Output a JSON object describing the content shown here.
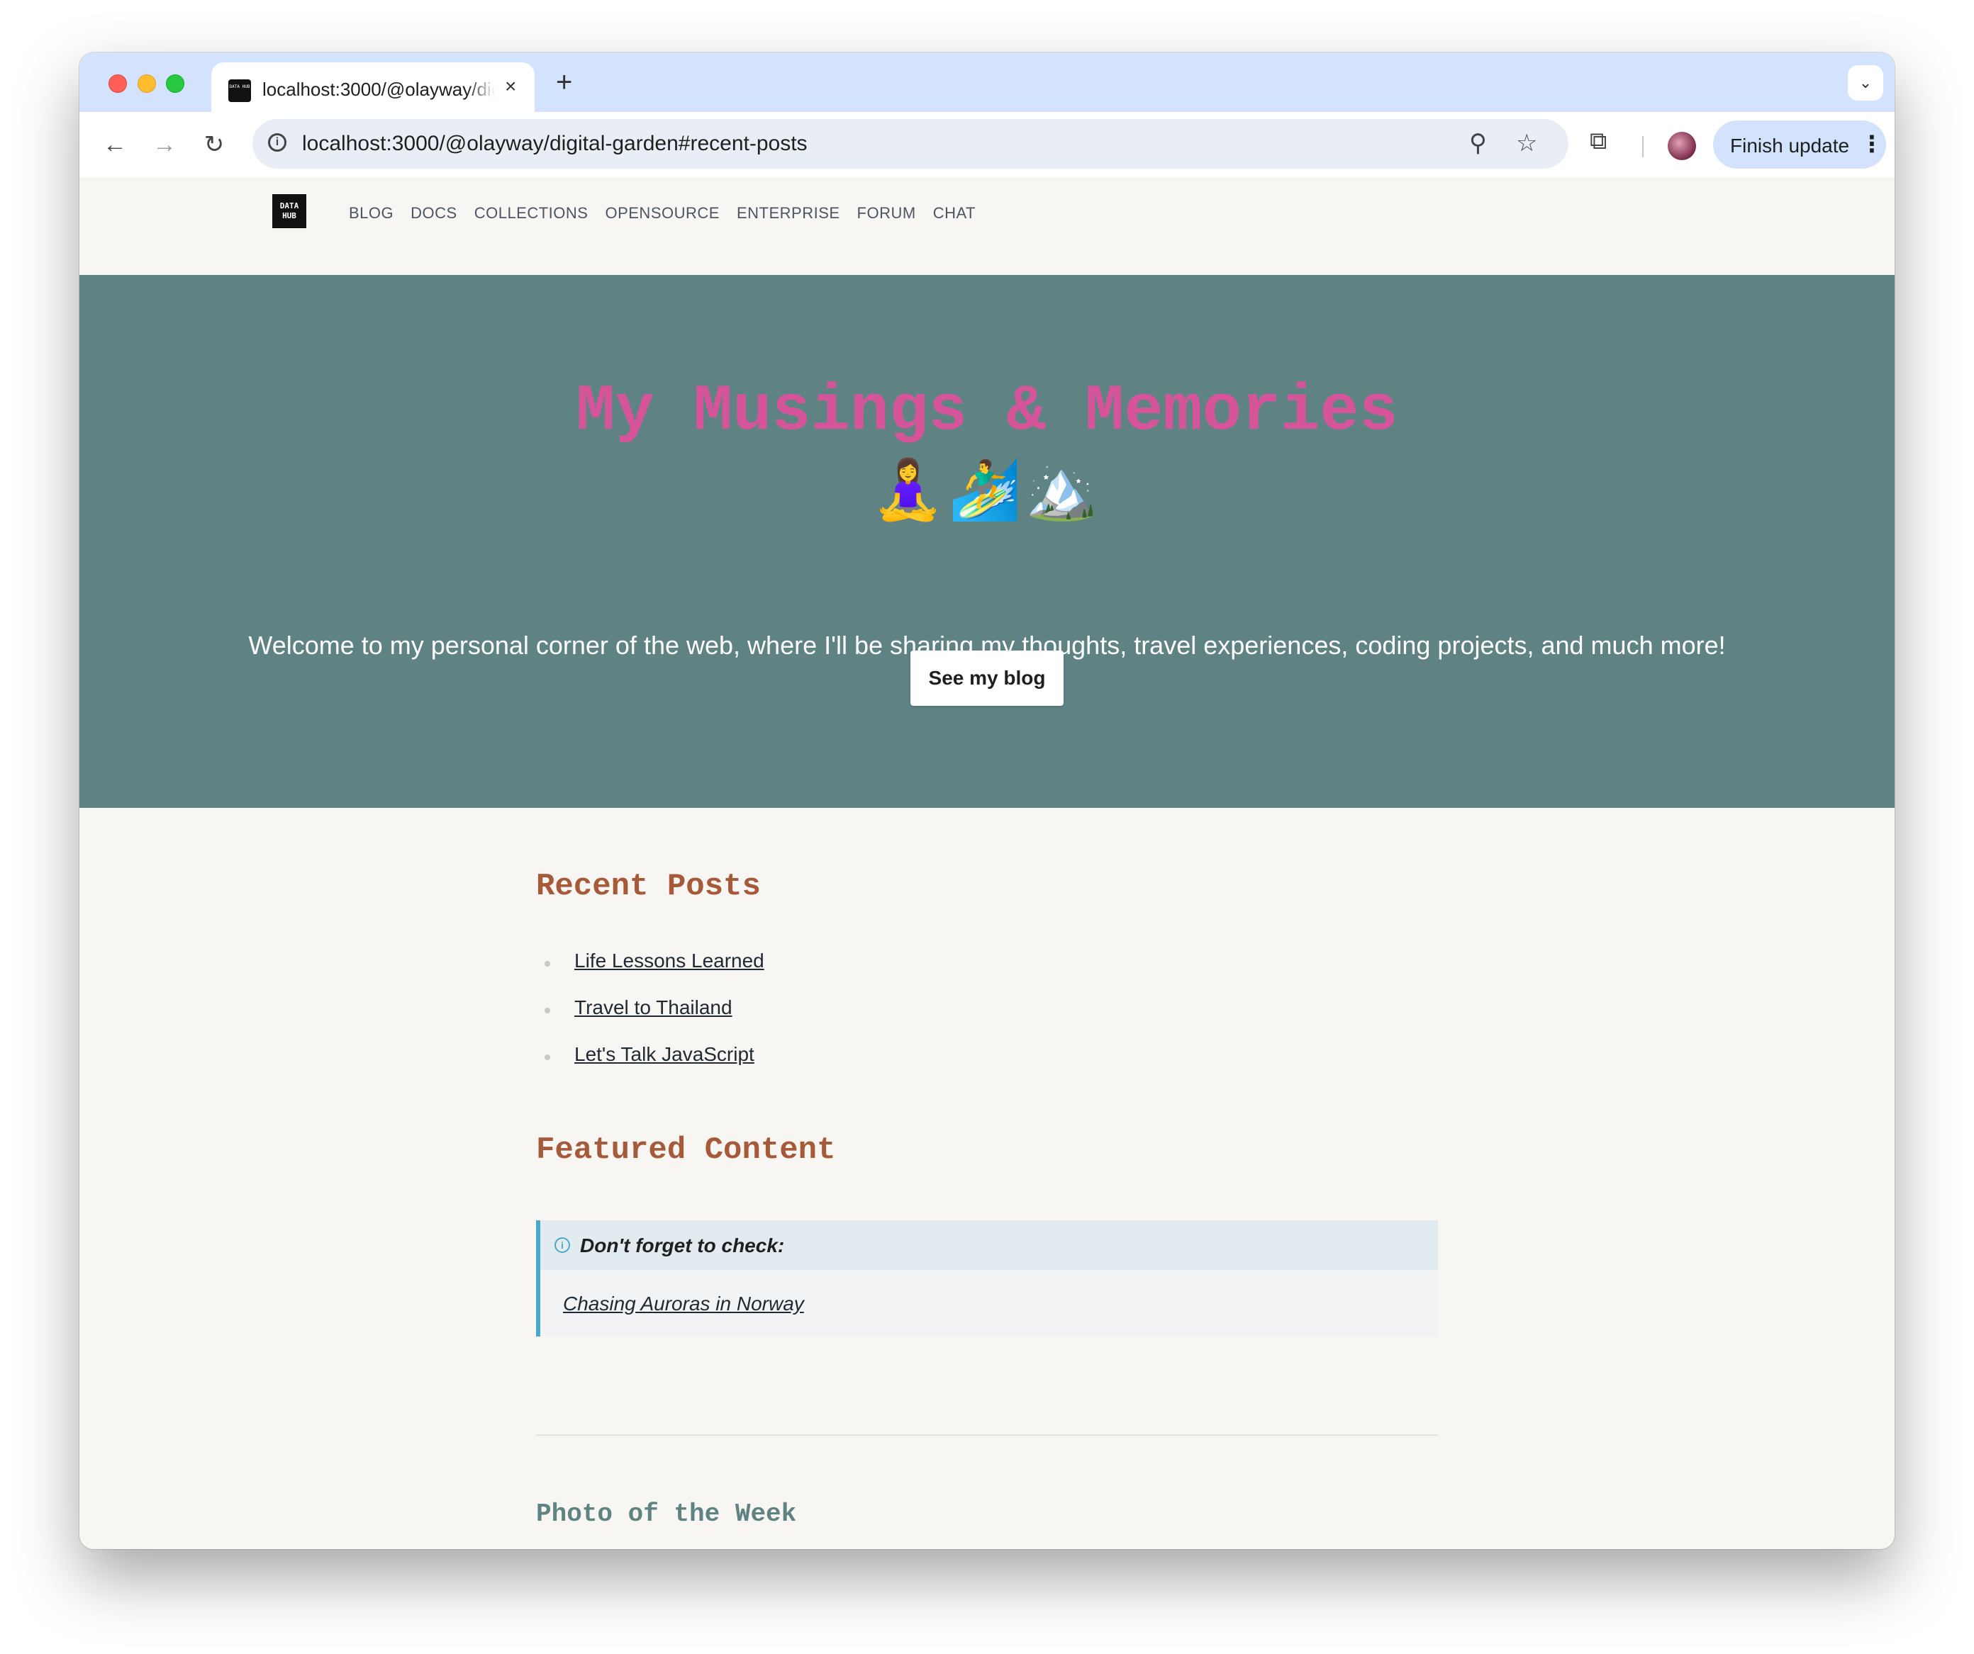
{
  "browser": {
    "tab_title": "localhost:3000/@olayway/digital-garden",
    "tab_close": "×",
    "new_tab": "+",
    "tab_menu": "⌄",
    "url": "localhost:3000/@olayway/digital-garden#recent-posts",
    "finish_update_label": "Finish update",
    "favicon_text": "DATA HUB"
  },
  "site": {
    "logo_text": "DATA HUB",
    "nav": [
      "BLOG",
      "DOCS",
      "COLLECTIONS",
      "OPENSOURCE",
      "ENTERPRISE",
      "FORUM",
      "CHAT"
    ]
  },
  "hero": {
    "title": "My Musings & Memories",
    "emoji": "🧘‍♀️🏄‍♂️🏔️",
    "subtitle": "Welcome to my personal corner of the web, where I'll be sharing my thoughts, travel experiences, coding projects, and much more!",
    "button_label": "See my blog",
    "bg_color": "#5f8383",
    "title_color": "#d6559a"
  },
  "recent_posts": {
    "heading": "Recent Posts",
    "items": [
      "Life Lessons Learned",
      "Travel to Thailand",
      "Let's Talk JavaScript"
    ]
  },
  "featured": {
    "heading": "Featured Content",
    "callout_title": "Don't forget to check:",
    "callout_link": "Chasing Auroras in Norway",
    "accent_color": "#4aa9c9"
  },
  "photo_of_week": {
    "heading": "Photo of the Week"
  }
}
